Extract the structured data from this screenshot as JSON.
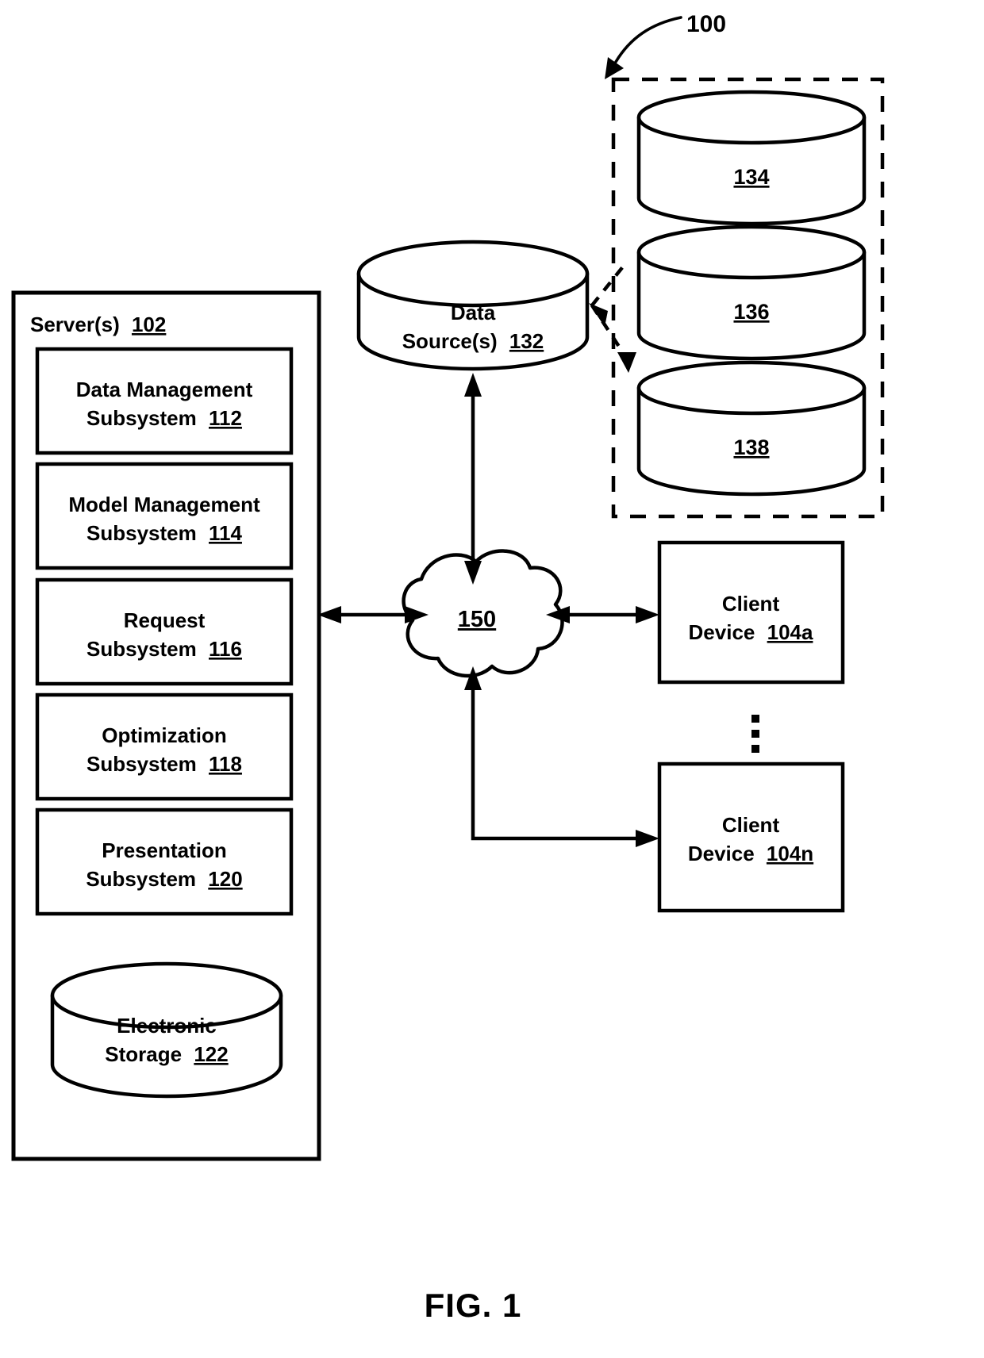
{
  "figure": {
    "caption": "FIG. 1",
    "system_ref": "100"
  },
  "server_panel": {
    "title_text": "Server(s)",
    "title_ref": "102",
    "subsystems": [
      {
        "line1": "Data Management",
        "line2": "Subsystem",
        "ref": "112"
      },
      {
        "line1": "Model Management",
        "line2": "Subsystem",
        "ref": "114"
      },
      {
        "line1": "Request",
        "line2": "Subsystem",
        "ref": "116"
      },
      {
        "line1": "Optimization",
        "line2": "Subsystem",
        "ref": "118"
      },
      {
        "line1": "Presentation",
        "line2": "Subsystem",
        "ref": "120"
      }
    ],
    "storage": {
      "line1": "Electronic",
      "line2": "Storage",
      "ref": "122"
    }
  },
  "data_source": {
    "line1": "Data",
    "line2": "Source(s)",
    "ref": "132"
  },
  "data_source_group": {
    "items": [
      {
        "ref": "134"
      },
      {
        "ref": "136"
      },
      {
        "ref": "138"
      }
    ]
  },
  "network": {
    "ref": "150"
  },
  "clients": [
    {
      "line1": "Client",
      "line2": "Device",
      "ref": "104a"
    },
    {
      "line1": "Client",
      "line2": "Device",
      "ref": "104n"
    }
  ],
  "ellipsis": {
    "symbol": "vertical-ellipsis"
  },
  "colors": {
    "ink": "#000000",
    "paper": "#ffffff"
  }
}
